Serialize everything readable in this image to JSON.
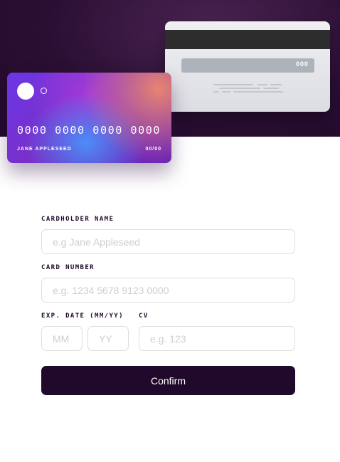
{
  "card_back": {
    "cvc": "000"
  },
  "card_front": {
    "number": "0000 0000 0000 0000",
    "name": "JANE APPLESEED",
    "expiry": "00/00"
  },
  "form": {
    "cardholder": {
      "label": "CARDHOLDER NAME",
      "placeholder": "e.g Jane Appleseed"
    },
    "number": {
      "label": "CARD NUMBER",
      "placeholder": "e.g. 1234 5678 9123 0000"
    },
    "expiry": {
      "label": "EXP. DATE (MM/YY)",
      "month_placeholder": "MM",
      "year_placeholder": "YY"
    },
    "cvc": {
      "label": "CV",
      "placeholder": "e.g. 123"
    },
    "confirm_label": "Confirm"
  },
  "colors": {
    "hero_background": "#21092b",
    "button": "#21092b",
    "input_border": "#dedce2"
  }
}
